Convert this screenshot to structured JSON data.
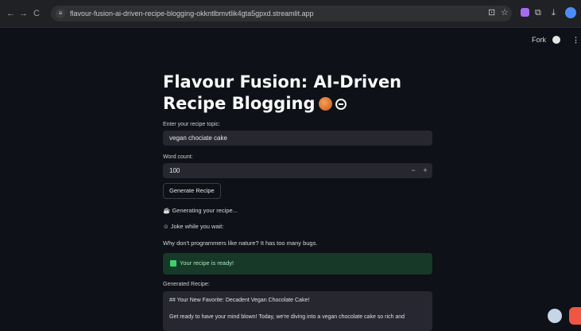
{
  "browser": {
    "back_icon": "←",
    "forward_icon": "→",
    "reload_icon": "C",
    "url": "flavour-fusion-ai-driven-recipe-blogging-okkntlbmvtlik4gta5gpxd.streamlit.app"
  },
  "app_header": {
    "fork_label": "Fork",
    "menu_icon": "⋮"
  },
  "main": {
    "title": "Flavour Fusion: AI-Driven Recipe Blogging",
    "topic_label": "Enter your recipe topic:",
    "topic_value": "vegan chociate cake",
    "word_count_label": "Word count:",
    "word_count_value": "100",
    "minus": "−",
    "plus": "+",
    "generate_button": "Generate Recipe",
    "generating_text": "Generating your recipe...",
    "joke_heading": "Joke while you wait:",
    "joke_text": "Why don't programmers like nature? It has too many bugs.",
    "success_text": "Your recipe is ready!",
    "generated_label": "Generated Recipe:",
    "recipe_line1": "## Your New Favorite: Decadent Vegan Chocolate Cake!",
    "recipe_line2": "Get ready to have your mind blown! Today, we're diving into a vegan chocolate cake so rich and"
  },
  "colors": {
    "background": "#0e1117",
    "input_bg": "#262730",
    "success_bg": "#173928",
    "success_text": "#a8e5bd"
  },
  "icons": {
    "generating_icon": "coffee-cup-icon",
    "joke_icon": "smiley-icon",
    "success_icon": "check-box-icon"
  }
}
